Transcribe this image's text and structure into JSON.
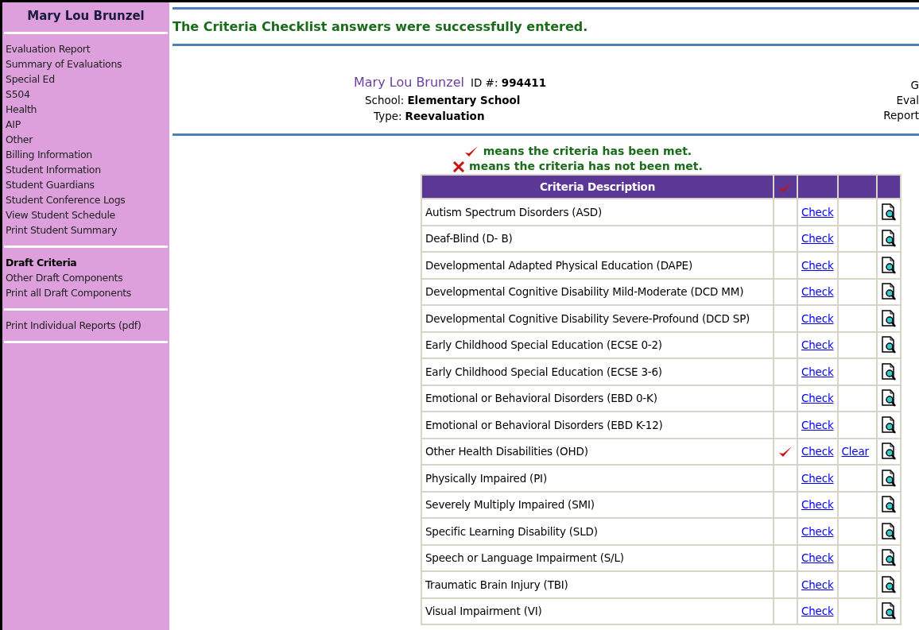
{
  "sidebar": {
    "title": "Mary Lou Brunzel",
    "groups": [
      {
        "items": [
          {
            "label": "Evaluation Report",
            "selected": false
          },
          {
            "label": "Summary of Evaluations",
            "selected": false
          },
          {
            "label": "Special Ed",
            "selected": false
          },
          {
            "label": "S504",
            "selected": false
          },
          {
            "label": "Health",
            "selected": false
          },
          {
            "label": "AIP",
            "selected": false
          },
          {
            "label": "Other",
            "selected": false
          },
          {
            "label": "Billing Information",
            "selected": false
          },
          {
            "label": "Student Information",
            "selected": false
          },
          {
            "label": "Student Guardians",
            "selected": false
          },
          {
            "label": "Student Conference Logs",
            "selected": false
          },
          {
            "label": "View Student Schedule",
            "selected": false
          },
          {
            "label": "Print Student Summary",
            "selected": false
          }
        ]
      },
      {
        "items": [
          {
            "label": "Draft Criteria",
            "selected": true
          },
          {
            "label": "Other Draft Components",
            "selected": false
          },
          {
            "label": "Print all Draft Components",
            "selected": false
          }
        ]
      },
      {
        "items": [
          {
            "label": "Print Individual Reports (pdf)",
            "selected": false
          }
        ]
      }
    ]
  },
  "message": "The Criteria Checklist answers were successfully entered.",
  "student": {
    "name": "Mary Lou Brunzel",
    "id_label": "ID #:",
    "id": "994411",
    "school_label": "School:",
    "school": "Elementary School",
    "type_label": "Type:",
    "type": "Reevaluation",
    "right_labels": [
      "G",
      "Eval",
      "Report"
    ]
  },
  "legend": {
    "met": "means the criteria has been met.",
    "not_met": "means the criteria has not been met."
  },
  "table": {
    "columns": [
      "Criteria Description"
    ],
    "rows": [
      {
        "description": "Autism Spectrum Disorders (ASD)",
        "met": false,
        "check": "Check"
      },
      {
        "description": "Deaf-Blind (D- B)",
        "met": false,
        "check": "Check"
      },
      {
        "description": "Developmental Adapted Physical Education (DAPE)",
        "met": false,
        "check": "Check"
      },
      {
        "description": "Developmental Cognitive Disability Mild-Moderate (DCD MM)",
        "met": false,
        "check": "Check"
      },
      {
        "description": "Developmental Cognitive Disability Severe-Profound (DCD SP)",
        "met": false,
        "check": "Check"
      },
      {
        "description": "Early Childhood Special Education (ECSE 0-2)",
        "met": false,
        "check": "Check"
      },
      {
        "description": "Early Childhood Special Education (ECSE 3-6)",
        "met": false,
        "check": "Check"
      },
      {
        "description": "Emotional or Behavioral Disorders (EBD 0-K)",
        "met": false,
        "check": "Check"
      },
      {
        "description": "Emotional or Behavioral Disorders (EBD K-12)",
        "met": false,
        "check": "Check"
      },
      {
        "description": "Other Health Disabilities (OHD)",
        "met": true,
        "check": "Check",
        "clear": "Clear"
      },
      {
        "description": "Physically Impaired (PI)",
        "met": false,
        "check": "Check"
      },
      {
        "description": "Severely Multiply Impaired (SMI)",
        "met": false,
        "check": "Check"
      },
      {
        "description": "Specific Learning Disability (SLD)",
        "met": false,
        "check": "Check"
      },
      {
        "description": "Speech or Language Impairment (S/L)",
        "met": false,
        "check": "Check"
      },
      {
        "description": "Traumatic Brain Injury (TBI)",
        "met": false,
        "check": "Check"
      },
      {
        "description": "Visual Impairment (VI)",
        "met": false,
        "check": "Check"
      }
    ]
  }
}
